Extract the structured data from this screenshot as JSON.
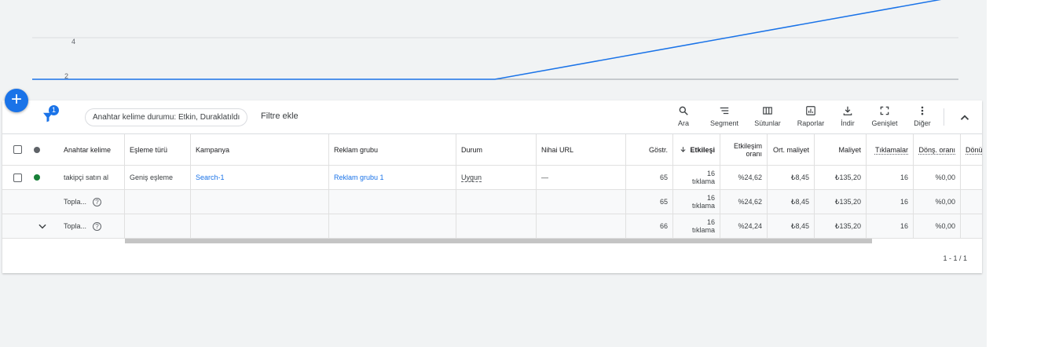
{
  "chart": {
    "y_ticks": [
      "4",
      "2"
    ]
  },
  "fab": {
    "icon": "plus-icon",
    "label": "+"
  },
  "filterbar": {
    "filter_badge": "1",
    "chip_label": "Anahtar kelime durumu: Etkin, Duraklatıldı",
    "add_filter": "Filtre ekle"
  },
  "toolbar": {
    "search": "Ara",
    "segment": "Segment",
    "columns": "Sütunlar",
    "reports": "Raporlar",
    "download": "İndir",
    "expand": "Genişlet",
    "more": "Diğer"
  },
  "table": {
    "headers": {
      "keyword": "Anahtar kelime",
      "match_type": "Eşleme türü",
      "campaign": "Kampanya",
      "ad_group": "Reklam grubu",
      "status": "Durum",
      "final_url": "Nihai URL",
      "impressions": "Göstr.",
      "interactions": "Etkileşi",
      "interaction_rate": "Etkileşim oranı",
      "avg_cost": "Ort. maliyet",
      "cost": "Maliyet",
      "clicks": "Tıklamalar",
      "conv_rate": "Dönş. oranı",
      "conv": "Dönü"
    },
    "rows": [
      {
        "keyword": "takipçi satın al",
        "match_type": "Geniş eşleme",
        "campaign": "Search-1",
        "ad_group": "Reklam grubu 1",
        "status": "Uygun",
        "final_url": "—",
        "impressions": "65",
        "interactions_num": "16",
        "interactions_unit": "tıklama",
        "interaction_rate": "%24,62",
        "avg_cost": "₺8,45",
        "cost": "₺135,20",
        "clicks": "16",
        "conv_rate": "%0,00"
      }
    ],
    "totals": [
      {
        "label": "Topla...",
        "impressions": "65",
        "interactions_num": "16",
        "interactions_unit": "tıklama",
        "interaction_rate": "%24,62",
        "avg_cost": "₺8,45",
        "cost": "₺135,20",
        "clicks": "16",
        "conv_rate": "%0,00"
      },
      {
        "label": "Topla...",
        "impressions": "66",
        "interactions_num": "16",
        "interactions_unit": "tıklama",
        "interaction_rate": "%24,24",
        "avg_cost": "₺8,45",
        "cost": "₺135,20",
        "clicks": "16",
        "conv_rate": "%0,00"
      }
    ],
    "help_icon": "?"
  },
  "pagination": "1 - 1 / 1",
  "colors": {
    "accent": "#1a73e8",
    "status_green": "#188038",
    "status_gray": "#5f6368"
  }
}
